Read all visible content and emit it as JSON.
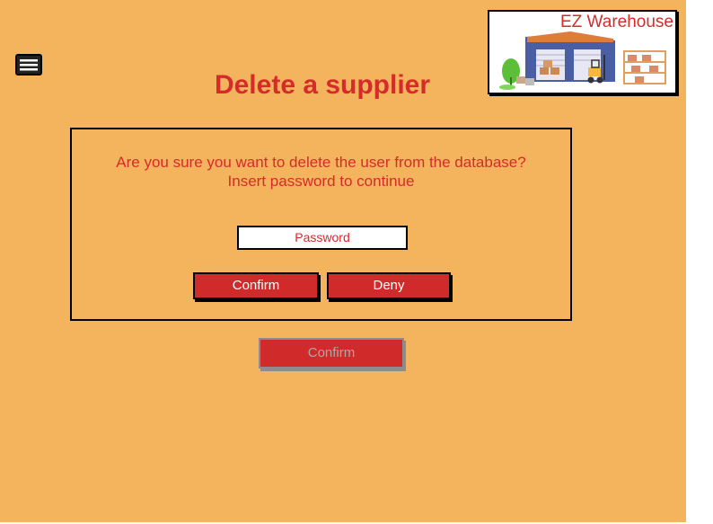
{
  "header": {
    "title": "Delete a supplier",
    "menu_icon": "menu-icon"
  },
  "logo": {
    "text": "EZ Warehouse",
    "image": "warehouse-illustration"
  },
  "dialog": {
    "message_line1": "Are you sure you want to delete the user from the database?",
    "message_line2": "Insert password to continue",
    "password_placeholder": "Password",
    "confirm_label": "Confirm",
    "deny_label": "Deny"
  },
  "footer": {
    "confirm_label": "Confirm",
    "confirm_disabled": true
  },
  "colors": {
    "background": "#f4b45e",
    "accent": "#d62b2b",
    "button": "#d12a2a"
  }
}
